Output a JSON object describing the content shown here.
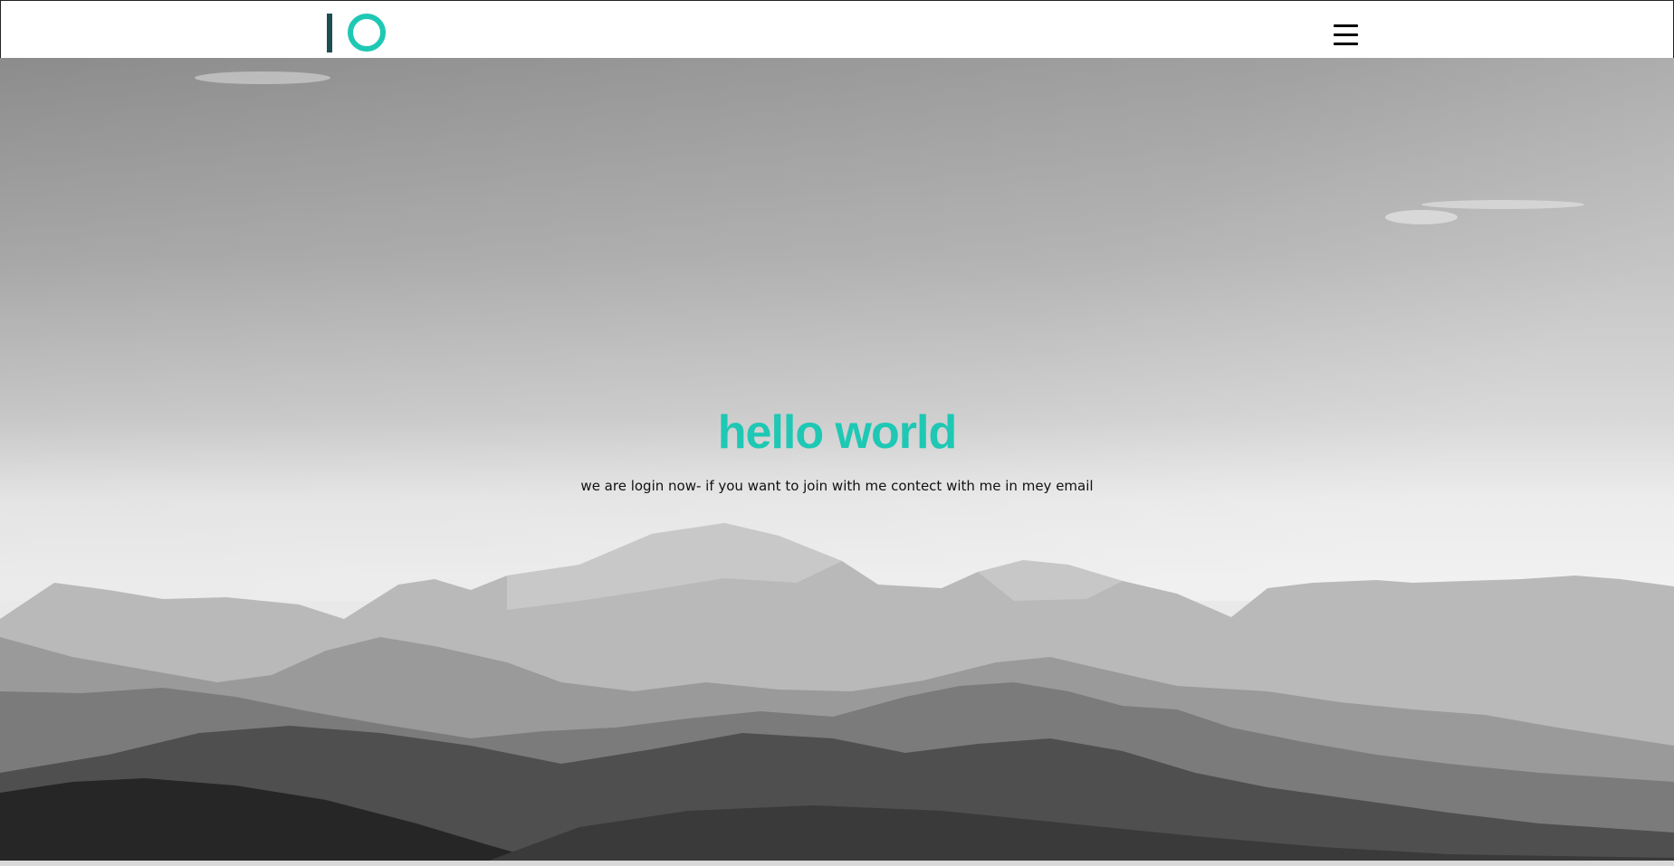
{
  "header": {
    "logo_text": "IO",
    "menu_icon": "hamburger-menu-icon"
  },
  "hero": {
    "title": "hello world",
    "subtitle": "we are login now- if you want to join with me contect with me in mey email",
    "background": "grayscale-mountain-landscape"
  },
  "colors": {
    "accent": "#1ec8b4",
    "logo_dark": "#1e4d52",
    "text": "#111111",
    "navbar_bg": "#ffffff"
  }
}
